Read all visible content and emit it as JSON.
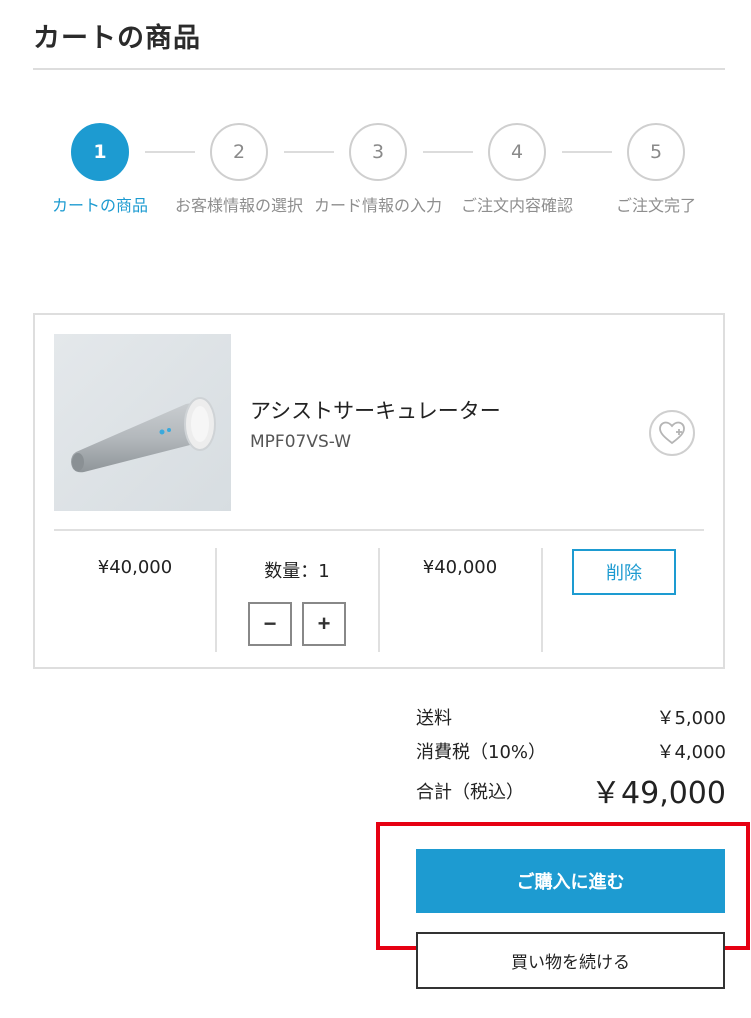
{
  "page": {
    "title": "カートの商品"
  },
  "stepper": {
    "steps": [
      {
        "number": "1",
        "label": "カートの商品",
        "active": true
      },
      {
        "number": "2",
        "label": "お客様情報の選択",
        "active": false
      },
      {
        "number": "3",
        "label": "カード情報の入力",
        "active": false
      },
      {
        "number": "4",
        "label": "ご注文内容確認",
        "active": false
      },
      {
        "number": "5",
        "label": "ご注文完了",
        "active": false
      }
    ]
  },
  "cart": {
    "item": {
      "name": "アシストサーキュレーター",
      "model": "MPF07VS-W",
      "unit_price": "¥40,000",
      "quantity_label": "数量：1",
      "quantity": 1,
      "line_total": "¥40,000",
      "decrement_label": "−",
      "increment_label": "+",
      "delete_label": "削除",
      "favorite_icon": "heart-plus-icon"
    }
  },
  "summary": {
    "shipping_label": "送料",
    "shipping_value": "￥5,000",
    "tax_label": "消費税（10%）",
    "tax_value": "￥4,000",
    "total_label": "合計（税込）",
    "total_value": "￥49,000"
  },
  "actions": {
    "checkout_label": "ご購入に進む",
    "continue_label": "買い物を続ける"
  },
  "colors": {
    "accent": "#1d9bd1",
    "highlight": "#e60012"
  }
}
